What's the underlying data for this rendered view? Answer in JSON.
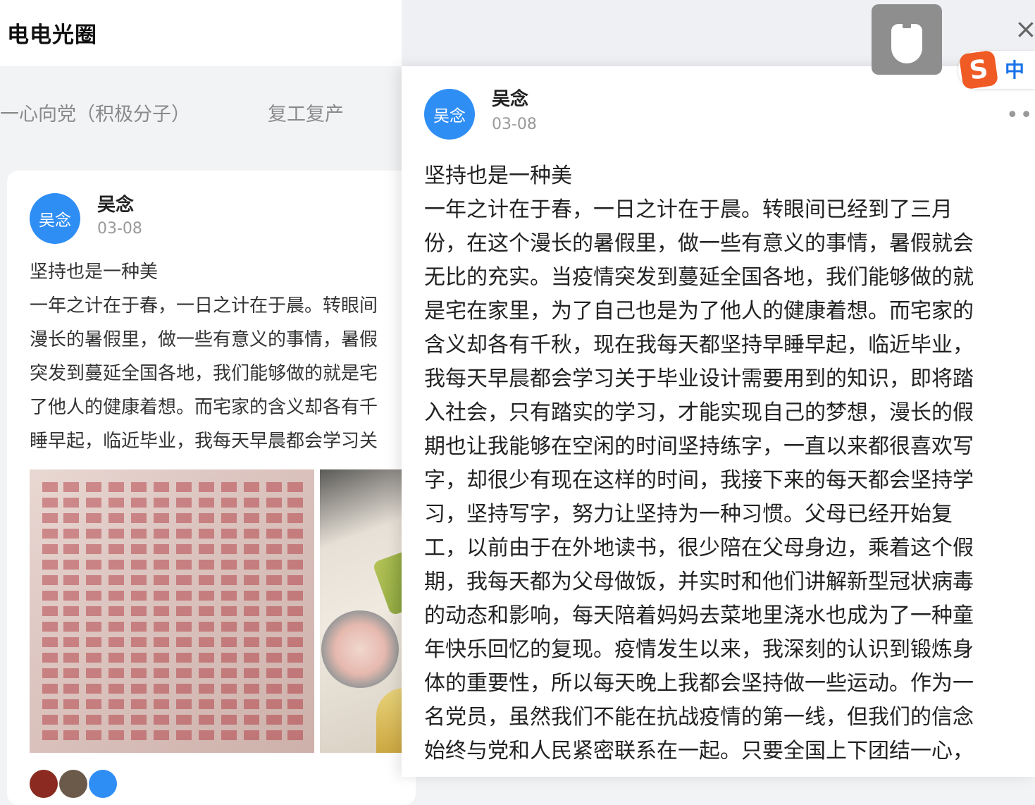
{
  "app": {
    "title": "电电光圈"
  },
  "categories": [
    {
      "label": "一心向党（积极分子）"
    },
    {
      "label": "复工复产"
    }
  ],
  "post": {
    "avatar_text": "吴念",
    "author": "吴念",
    "date": "03-08",
    "preview_lines": [
      "坚持也是一种美",
      "一年之计在于春，一日之计在于晨。转眼间",
      "漫长的暑假里，做一些有意义的事情，暑假",
      "突发到蔓延全国各地，我们能够做的就是宅",
      "了他人的健康着想。而宅家的含义却各有千",
      "睡早起，临近毕业，我每天早晨都会学习关"
    ]
  },
  "detail": {
    "avatar_text": "吴念",
    "author": "吴念",
    "date": "03-08",
    "more_label": "•••",
    "lines": [
      "坚持也是一种美",
      "一年之计在于春，一日之计在于晨。转眼间已经到了三月",
      "份，在这个漫长的暑假里，做一些有意义的事情，暑假就会",
      "无比的充实。当疫情突发到蔓延全国各地，我们能够做的就",
      "是宅在家里，为了自己也是为了他人的健康着想。而宅家的",
      "含义却各有千秋，现在我每天都坚持早睡早起，临近毕业，",
      "我每天早晨都会学习关于毕业设计需要用到的知识，即将踏",
      "入社会，只有踏实的学习，才能实现自己的梦想，漫长的假",
      "期也让我能够在空闲的时间坚持练字，一直以来都很喜欢写",
      "字，却很少有现在这样的时间，我接下来的每天都会坚持学",
      "习，坚持写字，努力让坚持为一种习惯。父母已经开始复",
      "工，以前由于在外地读书，很少陪在父母身边，乘着这个假",
      "期，我每天都为父母做饭，并实时和他们讲解新型冠状病毒",
      "的动态和影响，每天陪着妈妈去菜地里浇水也成为了一种童",
      "年快乐回忆的复现。疫情发生以来，我深刻的认识到锻炼身",
      "体的重要性，所以每天晚上我都会坚持做一些运动。作为一",
      "名党员，虽然我们不能在抗战疫情的第一线，但我们的信念",
      "始终与党和人民紧密联系在一起。只要全国上下团结一心，"
    ]
  },
  "overlay": {
    "close_glyph": "×",
    "ime_logo": "S",
    "ime_mode": "中"
  },
  "icons": [
    "close-icon",
    "microphone-icon",
    "more-icon",
    "ime-logo-icon"
  ],
  "colors": {
    "accent": "#2f8ef4",
    "ime_orange": "#f05a24",
    "ime_blue": "#1a73e8"
  }
}
